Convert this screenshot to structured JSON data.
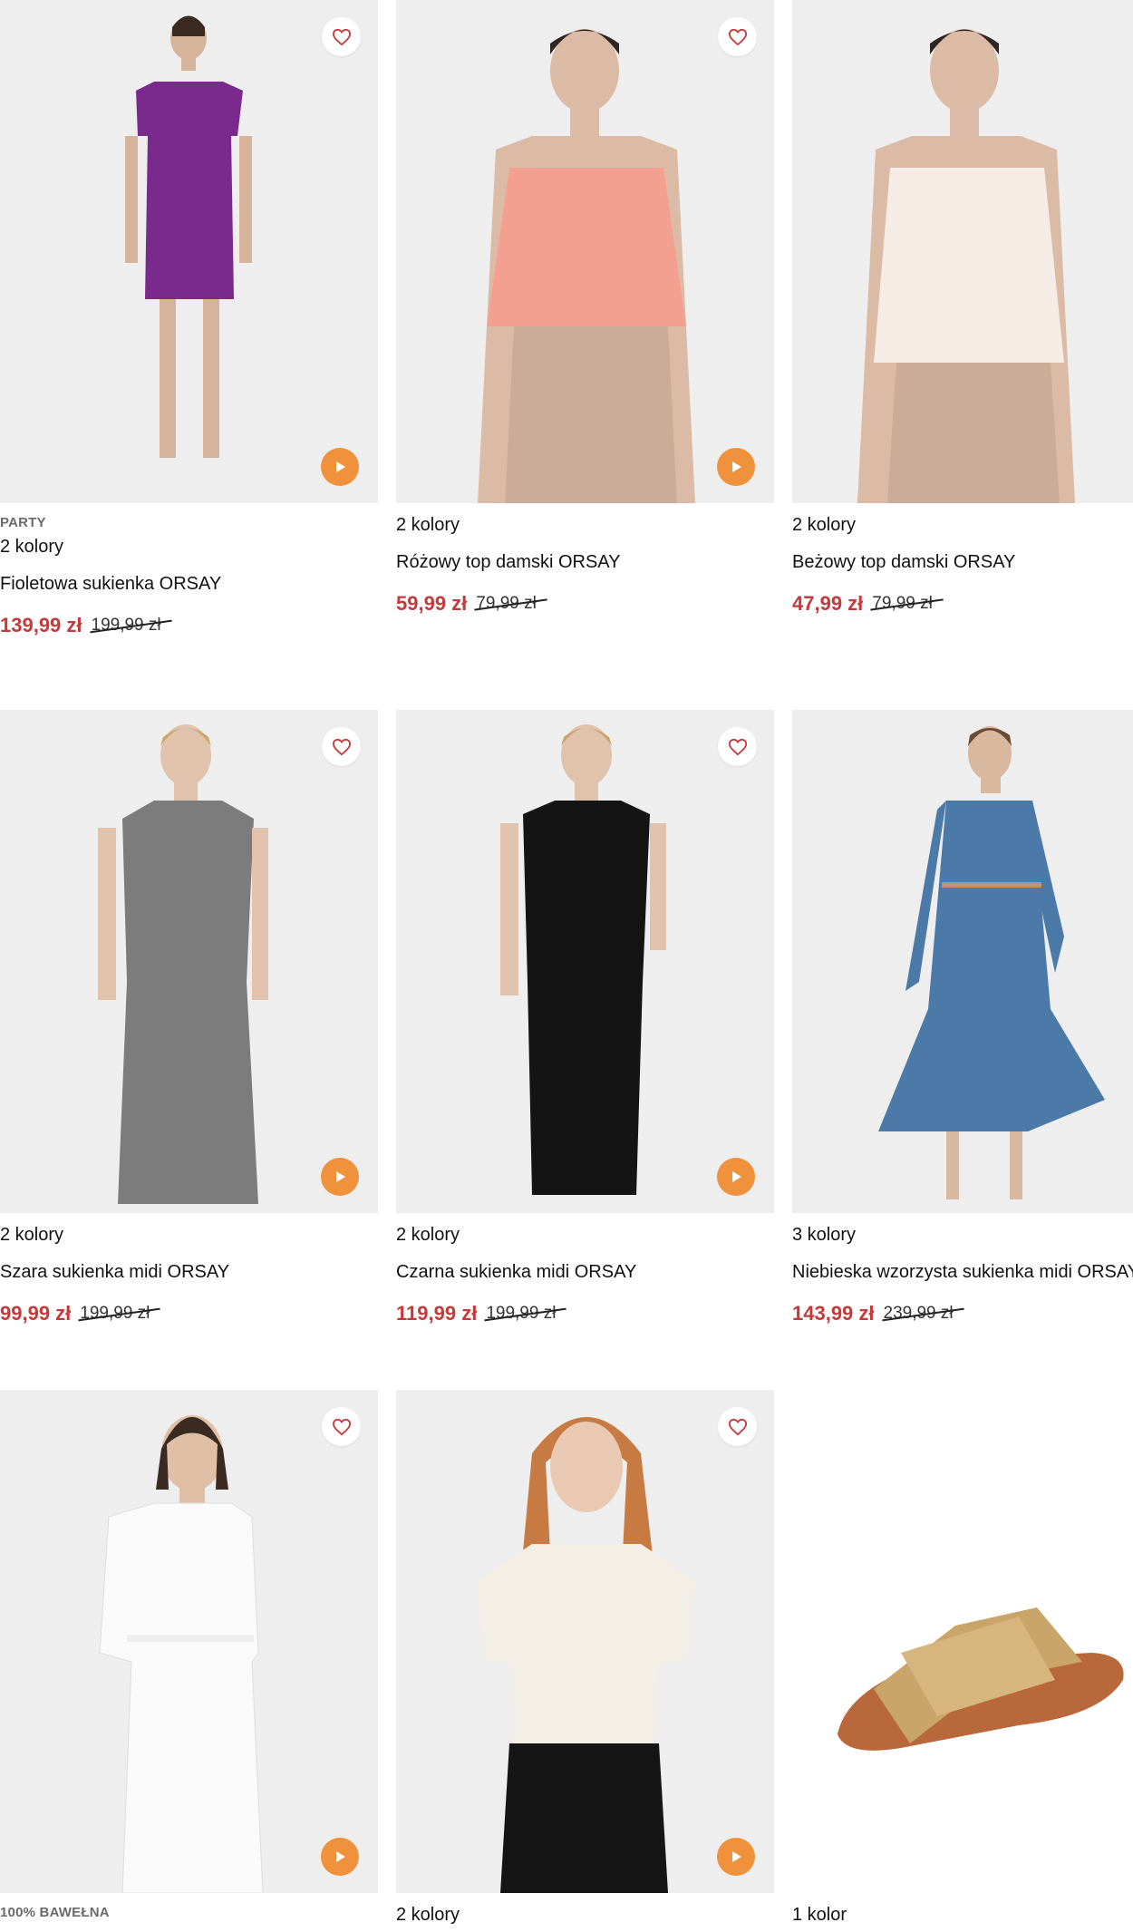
{
  "products": [
    {
      "tag": "PARTY",
      "colors": "2 kolory",
      "name": "Fioletowa sukienka ORSAY",
      "price": "139,99 zł",
      "old_price": "199,99 zł"
    },
    {
      "tag": "",
      "colors": "2 kolory",
      "name": "Różowy top damski ORSAY",
      "price": "59,99 zł",
      "old_price": "79,99 zł"
    },
    {
      "tag": "",
      "colors": "2 kolory",
      "name": "Beżowy top damski ORSAY",
      "price": "47,99 zł",
      "old_price": "79,99 zł"
    },
    {
      "tag": "",
      "colors": "2 kolory",
      "name": "Szara sukienka midi ORSAY",
      "price": "99,99 zł",
      "old_price": "199,99 zł"
    },
    {
      "tag": "",
      "colors": "2 kolory",
      "name": "Czarna sukienka midi ORSAY",
      "price": "119,99 zł",
      "old_price": "199,99 zł"
    },
    {
      "tag": "",
      "colors": "3 kolory",
      "name": "Niebieska wzorzysta sukienka midi ORSAY",
      "price": "143,99 zł",
      "old_price": "239,99 zł"
    },
    {
      "tag": "100% BAWEŁNA",
      "colors": "",
      "name": "",
      "price": "",
      "old_price": ""
    },
    {
      "tag": "",
      "colors": "2 kolory",
      "name": "",
      "price": "",
      "old_price": ""
    },
    {
      "tag": "",
      "colors": "1 kolor",
      "name": "",
      "price": "",
      "old_price": ""
    }
  ],
  "icons": {
    "favorite": "heart-icon",
    "video": "play-icon"
  },
  "accent_color": "#f0923c",
  "sale_color": "#c43a3a"
}
